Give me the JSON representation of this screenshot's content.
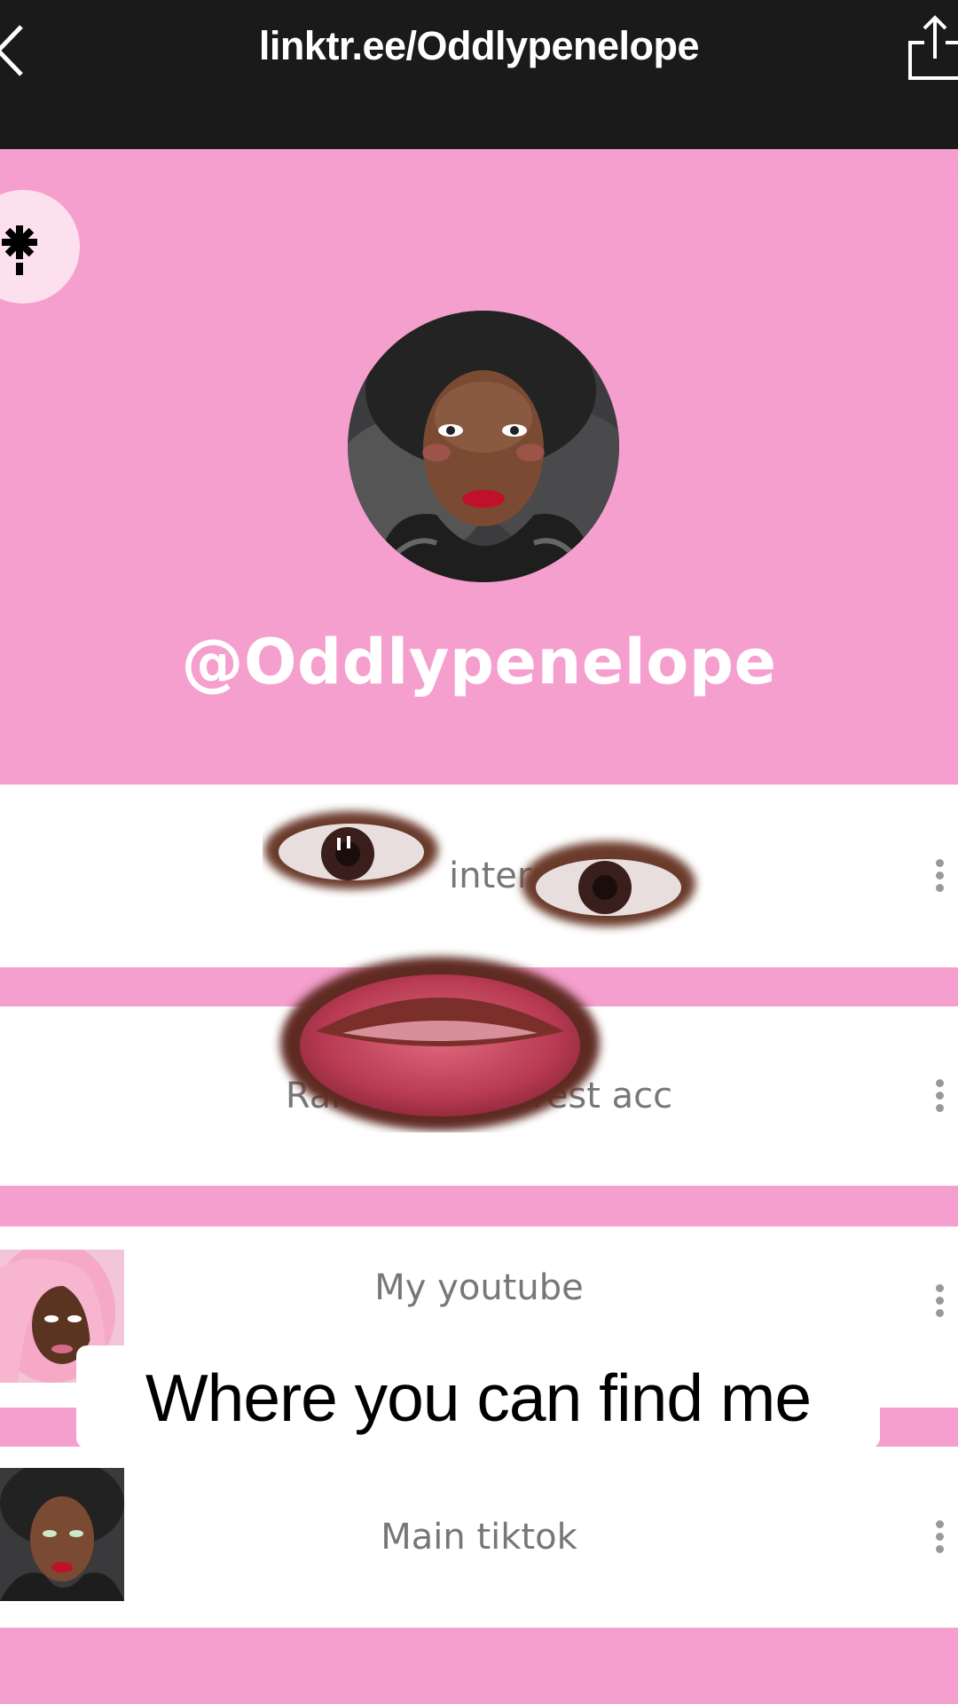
{
  "browser": {
    "url": "linktr.ee/Oddlypenelope",
    "back_icon": "chevron-left-icon",
    "share_icon": "share-icon"
  },
  "profile": {
    "logo_icon": "linktree-asterisk-icon",
    "handle": "@Oddlypenelope",
    "avatar": "profile-photo"
  },
  "links": [
    {
      "label": "Main Pinterest",
      "visible_text": "interes",
      "thumbnail": false
    },
    {
      "label": "Random Pinterest acc",
      "thumbnail": false
    },
    {
      "label": "My youtube",
      "thumbnail": true
    },
    {
      "label": "Main tiktok",
      "thumbnail": true
    }
  ],
  "caption": "Where you can find me",
  "colors": {
    "background_pink": "#f59fce",
    "topbar": "#1a1a1b",
    "link_bg": "#ffffff",
    "link_text": "#777777"
  }
}
